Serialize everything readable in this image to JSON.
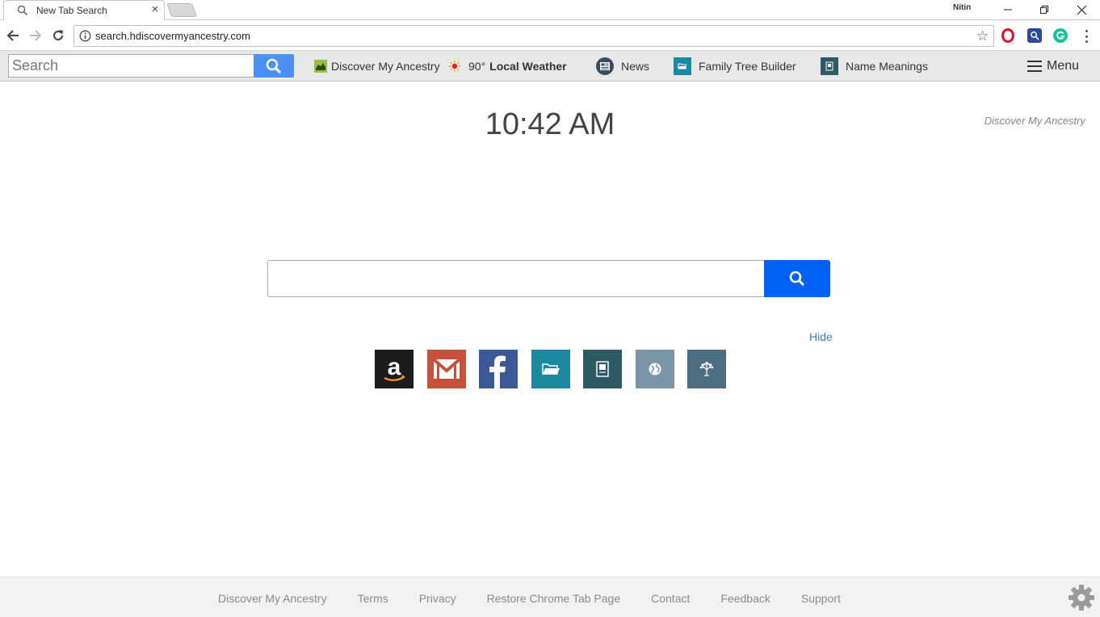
{
  "browser": {
    "tab_title": "New Tab Search",
    "tab_close": "×",
    "profile_name": "Nitin",
    "url": "search.hdiscovermyancestry.com"
  },
  "toolbar": {
    "search_placeholder": "Search",
    "items": [
      {
        "label": "Discover My Ancestry",
        "icon": "ancestry-logo-icon"
      },
      {
        "label_prefix": "90°",
        "label_bold": "Local Weather",
        "icon": "weather-sun-icon"
      },
      {
        "label": "News",
        "icon": "news-icon"
      },
      {
        "label": "Family Tree Builder",
        "icon": "folder-icon"
      },
      {
        "label": "Name Meanings",
        "icon": "book-icon"
      }
    ],
    "menu_label": "Menu",
    "accent": "#4c8ff5"
  },
  "main": {
    "clock": "10:42 AM",
    "brand": "Discover My Ancestry",
    "search_value": "",
    "hide_label": "Hide",
    "search_button_color": "#0061f2",
    "tiles": [
      {
        "name": "amazon",
        "color": "#1c1c1c"
      },
      {
        "name": "gmail",
        "color": "#c6503a"
      },
      {
        "name": "facebook",
        "color": "#3b5998"
      },
      {
        "name": "family-tree-builder",
        "color": "#1b8aa0"
      },
      {
        "name": "name-meanings",
        "color": "#2d5a63"
      },
      {
        "name": "ancestry-globe",
        "color": "#7a96a6"
      },
      {
        "name": "ancestry-tree",
        "color": "#4b6e80"
      }
    ]
  },
  "footer": {
    "links": [
      "Discover My Ancestry",
      "Terms",
      "Privacy",
      "Restore Chrome Tab Page",
      "Contact",
      "Feedback",
      "Support"
    ]
  }
}
